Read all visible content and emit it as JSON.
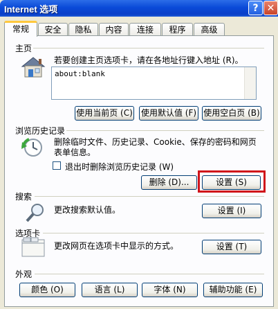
{
  "window": {
    "title": "Internet 选项",
    "help_symbol": "?",
    "close_symbol": "✕"
  },
  "tabs": [
    {
      "label": "常规",
      "active": true
    },
    {
      "label": "安全"
    },
    {
      "label": "隐私"
    },
    {
      "label": "内容"
    },
    {
      "label": "连接"
    },
    {
      "label": "程序"
    },
    {
      "label": "高级"
    }
  ],
  "homepage": {
    "title": "主页",
    "description": "若要创建主页选项卡，请在各地址行键入地址 (R)。",
    "address_value": "about:blank",
    "buttons": {
      "use_current": "使用当前页 (C)",
      "use_default": "使用默认值 (F)",
      "use_blank": "使用空白页 (B)"
    }
  },
  "history": {
    "title": "浏览历史记录",
    "description_line1": "删除临时文件、历史记录、Cookie、保存的密码和网页",
    "description_line2": "表单信息。",
    "checkbox_label": "退出时删除浏览历史记录 (W)",
    "checkbox_checked": false,
    "delete_button": "删除 (D)...",
    "settings_button": "设置 (S)"
  },
  "search": {
    "title": "搜索",
    "description": "更改搜索默认值。",
    "settings_button": "设置 (I)"
  },
  "tabs_section": {
    "title": "选项卡",
    "description": "更改网页在选项卡中显示的方式。",
    "settings_button": "设置 (T)"
  },
  "appearance": {
    "title": "外观",
    "buttons": {
      "colors": "颜色 (O)",
      "languages": "语言 (L)",
      "fonts": "字体 (N)",
      "accessibility": "辅助功能 (E)"
    }
  },
  "icons": {
    "homepage": "house-icon",
    "history": "clock-arrow-icon",
    "search": "magnifier-icon",
    "tabs": "tabbed-window-icon"
  },
  "colors": {
    "highlight": "#D0121A",
    "titlebar": "#0A4AD8",
    "tab_accent": "#FFC83C"
  }
}
